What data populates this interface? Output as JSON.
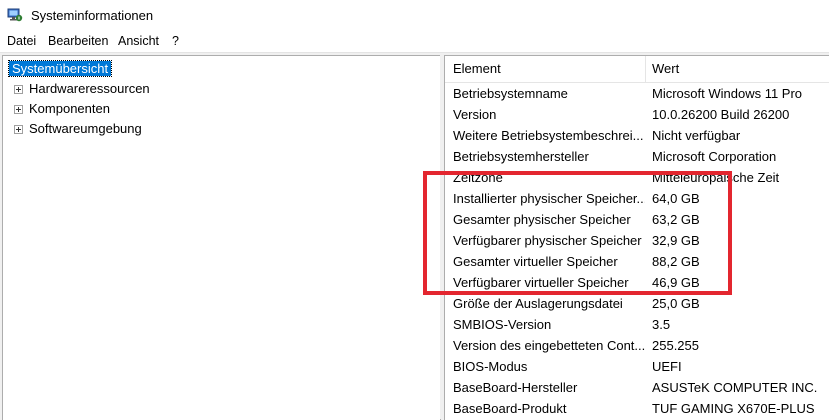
{
  "window": {
    "title": "Systeminformationen",
    "icon": "system-info-icon"
  },
  "menu": {
    "items": [
      "Datei",
      "Bearbeiten",
      "Ansicht",
      "?"
    ]
  },
  "tree": {
    "selected": "Systemübersicht",
    "children": [
      "Hardwareressourcen",
      "Komponenten",
      "Softwareumgebung"
    ]
  },
  "table": {
    "columns": [
      "Element",
      "Wert"
    ],
    "rows": [
      {
        "element": "Betriebsystemname",
        "value": "Microsoft Windows 11 Pro"
      },
      {
        "element": "Version",
        "value": "10.0.26200 Build 26200"
      },
      {
        "element": "Weitere Betriebsystembeschrei...",
        "value": "Nicht verfügbar"
      },
      {
        "element": "Betriebsystemhersteller",
        "value": "Microsoft Corporation"
      },
      {
        "element": "Zeitzone",
        "value": "Mitteleuropäische Zeit"
      },
      {
        "element": "Installierter physischer Speicher...",
        "value": "64,0 GB"
      },
      {
        "element": "Gesamter physischer Speicher",
        "value": "63,2 GB"
      },
      {
        "element": "Verfügbarer physischer Speicher",
        "value": "32,9 GB"
      },
      {
        "element": "Gesamter virtueller Speicher",
        "value": "88,2 GB"
      },
      {
        "element": "Verfügbarer virtueller Speicher",
        "value": "46,9 GB"
      },
      {
        "element": "Größe der Auslagerungsdatei",
        "value": "25,0 GB"
      },
      {
        "element": "SMBIOS-Version",
        "value": "3.5"
      },
      {
        "element": "Version des eingebetteten Cont...",
        "value": "255.255"
      },
      {
        "element": "BIOS-Modus",
        "value": "UEFI"
      },
      {
        "element": "BaseBoard-Hersteller",
        "value": "ASUSTeK COMPUTER INC."
      },
      {
        "element": "BaseBoard-Produkt",
        "value": "TUF GAMING X670E-PLUS"
      }
    ]
  },
  "annotation": {
    "color": "#e3262f"
  }
}
